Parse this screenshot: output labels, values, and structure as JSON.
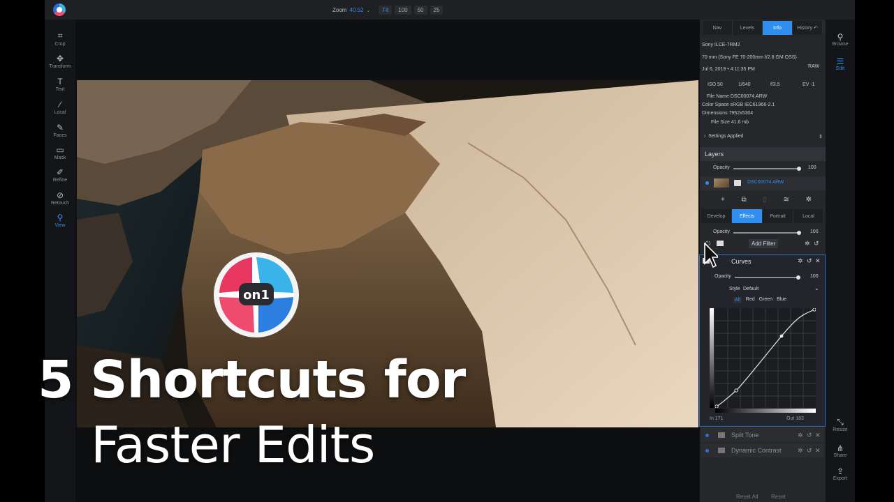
{
  "colors": {
    "accent": "#2f8ff0",
    "panel": "#25272b",
    "canvas": "#0e0f11"
  },
  "toolbar": {
    "zoom_label": "Zoom",
    "zoom_value": "40.52",
    "zoom_buttons": [
      "Fit",
      "100",
      "50",
      "25"
    ]
  },
  "left_tools": [
    {
      "label": "Crop",
      "icon": "crop-icon"
    },
    {
      "label": "Transform",
      "icon": "move-icon"
    },
    {
      "label": "Text",
      "icon": "text-icon"
    },
    {
      "label": "Local",
      "icon": "brush-icon"
    },
    {
      "label": "Faces",
      "icon": "face-icon"
    },
    {
      "label": "Mask",
      "icon": "mask-icon"
    },
    {
      "label": "Refine",
      "icon": "refine-icon"
    },
    {
      "label": "Retouch",
      "icon": "bandage-icon"
    },
    {
      "label": "View",
      "icon": "view-icon"
    }
  ],
  "right_tools": [
    {
      "label": "Browse",
      "icon": "browse-icon"
    },
    {
      "label": "Edit",
      "icon": "sliders-icon"
    },
    {
      "label": "Resize",
      "icon": "resize-icon"
    },
    {
      "label": "Share",
      "icon": "share-icon"
    },
    {
      "label": "Export",
      "icon": "export-icon"
    }
  ],
  "panel_tabs": [
    "Nav",
    "Levels",
    "Info",
    "History"
  ],
  "info": {
    "camera": "Sony ILCE-7RM2",
    "lens": "70 mm (Sony FE 70-200mm f/2.8 GM OSS)",
    "date": "Jul 6, 2019 • 4:11:35 PM",
    "format": "RAW",
    "iso": "ISO 50",
    "shutter": "1/640",
    "aperture": "f/3.5",
    "ev": "EV -1",
    "file_name": "File Name DSC00074.ARW",
    "color_space": "Color Space sRGB IEC61966-2.1",
    "dimensions": "Dimensions 7952x5304",
    "file_size": "File Size 41.6 mb",
    "settings_applied": "Settings Applied"
  },
  "layers": {
    "title": "Layers",
    "opacity_label": "Opacity",
    "opacity_value": "100",
    "layer_name": "DSC00074.ARW"
  },
  "edit_tabs": [
    "Develop",
    "Effects",
    "Portrait",
    "Local"
  ],
  "effects": {
    "opacity_label": "Opacity",
    "opacity_value": "100",
    "add_filter": "Add Filter"
  },
  "curves": {
    "title": "Curves",
    "opacity_label": "Opacity",
    "opacity_value": "100",
    "style_label": "Style",
    "style_value": "Default",
    "channels": [
      "All",
      "Red",
      "Green",
      "Blue"
    ],
    "in_label": "In 171",
    "out_label": "Out 183"
  },
  "filters": [
    "Split Tone",
    "Dynamic Contrast"
  ],
  "bottom": {
    "reset_all": "Reset All",
    "reset": "Reset"
  },
  "overlay": {
    "line1": "5 Shortcuts for",
    "line2": "Faster Edits",
    "logo_text": "on1"
  }
}
